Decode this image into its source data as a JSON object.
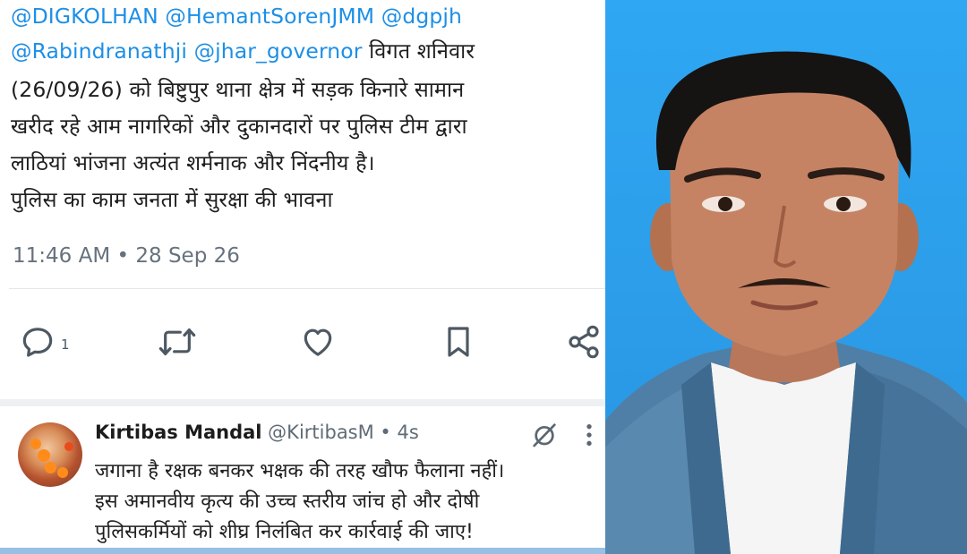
{
  "tweet": {
    "lines": [
      {
        "mentions": "@DIGKOLHAN @HemantSorenJMM @dgpjh",
        "text": ""
      },
      {
        "mentions": "@Rabindranathji @jhar_governor",
        "text": " विगत शनिवार"
      },
      {
        "mentions": "",
        "text": "(26/09/26) को बिष्टुपुर थाना क्षेत्र में सड़क किनारे सामान"
      },
      {
        "mentions": "",
        "text": "खरीद रहे आम नागरिकों और  दुकानदारों पर पुलिस टीम द्वारा"
      },
      {
        "mentions": "",
        "text": "लाठियां भांजना अत्यंत शर्मनाक और निंदनीय है।"
      },
      {
        "mentions": "",
        "text": "पुलिस का काम जनता में सुरक्षा की भावना"
      }
    ],
    "timestamp": "11:46 AM • 28 Sep 26",
    "reply_count": "1",
    "actions": {
      "reply_icon": "reply-bubble-icon",
      "retweet_icon": "retweet-icon",
      "like_icon": "heart-icon",
      "bookmark_icon": "bookmark-icon",
      "share_icon": "share-icon"
    }
  },
  "reply": {
    "name": "Kirtibas Mandal",
    "handle": " @KirtibasM",
    "time": " • 4s",
    "lines": [
      "जगाना है रक्षक बनकर भक्षक की तरह खौफ फैलाना नहीं।",
      "इस अमानवीय कृत्य की उच्च स्तरीय जांच हो और दोषी",
      "पुलिसकर्मियों को शीघ्र निलंबित कर कार्रवाई की जाए!"
    ],
    "grok_icon": "grok-icon",
    "more_icon": "more-vertical-icon"
  },
  "colors": {
    "mention": "#1d8fe6",
    "background_blue": "#2b9be8",
    "muted_text": "#66727e"
  }
}
